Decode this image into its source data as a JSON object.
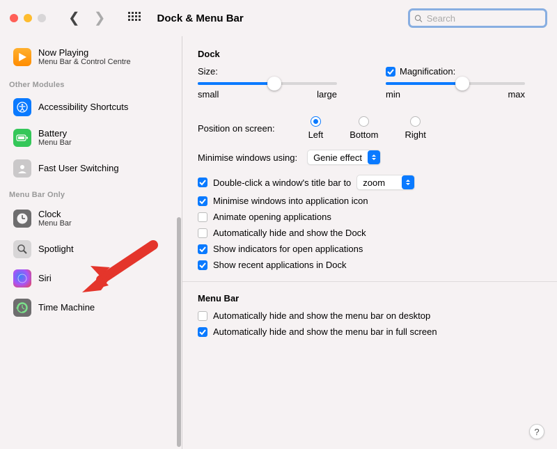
{
  "window": {
    "title": "Dock & Menu Bar",
    "search_placeholder": "Search"
  },
  "sidebar": {
    "items_top": [
      {
        "label": "Now Playing",
        "sub": "Menu Bar & Control Centre"
      }
    ],
    "section_other": "Other Modules",
    "items_other": [
      {
        "label": "Accessibility Shortcuts",
        "sub": ""
      },
      {
        "label": "Battery",
        "sub": "Menu Bar"
      },
      {
        "label": "Fast User Switching",
        "sub": ""
      }
    ],
    "section_menubar_only": "Menu Bar Only",
    "items_menubar": [
      {
        "label": "Clock",
        "sub": "Menu Bar"
      },
      {
        "label": "Spotlight",
        "sub": ""
      },
      {
        "label": "Siri",
        "sub": ""
      },
      {
        "label": "Time Machine",
        "sub": ""
      }
    ]
  },
  "dock": {
    "section_title": "Dock",
    "size_label": "Size:",
    "size_min": "small",
    "size_max": "large",
    "mag_label": "Magnification:",
    "mag_min": "min",
    "mag_max": "max",
    "position_label": "Position on screen:",
    "position_options": [
      "Left",
      "Bottom",
      "Right"
    ],
    "min_windows_label": "Minimise windows using:",
    "min_windows_value": "Genie effect",
    "dblclick_prefix": "Double-click a window's title bar to",
    "dblclick_value": "zoom",
    "opts": [
      {
        "label": "Minimise windows into application icon",
        "checked": true
      },
      {
        "label": "Animate opening applications",
        "checked": false
      },
      {
        "label": "Automatically hide and show the Dock",
        "checked": false
      },
      {
        "label": "Show indicators for open applications",
        "checked": true
      },
      {
        "label": "Show recent applications in Dock",
        "checked": true
      }
    ]
  },
  "menubar": {
    "section_title": "Menu Bar",
    "opts": [
      {
        "label": "Automatically hide and show the menu bar on desktop",
        "checked": false
      },
      {
        "label": "Automatically hide and show the menu bar in full screen",
        "checked": true
      }
    ]
  },
  "help_label": "?"
}
